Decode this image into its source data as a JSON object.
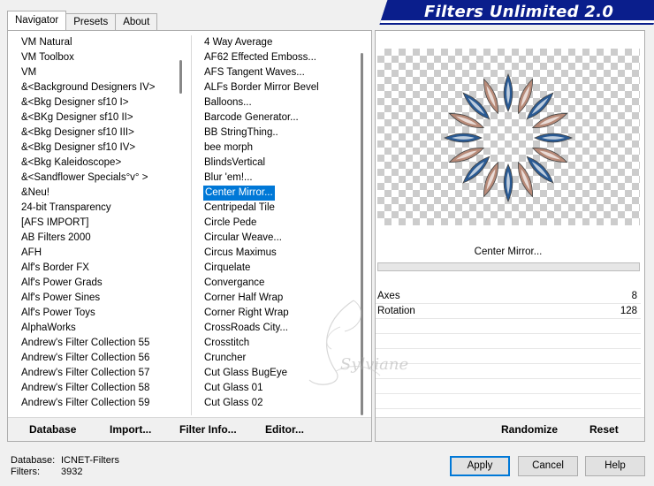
{
  "tabs": [
    "Navigator",
    "Presets",
    "About"
  ],
  "banner_title": "Filters Unlimited 2.0",
  "categories": [
    "VM Natural",
    "VM Toolbox",
    "VM",
    "&<Background Designers IV>",
    "&<Bkg Designer sf10 I>",
    "&<BKg Designer sf10 II>",
    "&<Bkg Designer sf10 III>",
    "&<Bkg Designer sf10 IV>",
    "&<Bkg Kaleidoscope>",
    "&<Sandflower Specials°v° >",
    "&Neu!",
    "24-bit Transparency",
    "[AFS IMPORT]",
    "AB Filters 2000",
    "AFH",
    "Alf's Border FX",
    "Alf's Power Grads",
    "Alf's Power Sines",
    "Alf's Power Toys",
    "AlphaWorks",
    "Andrew's Filter Collection 55",
    "Andrew's Filter Collection 56",
    "Andrew's Filter Collection 57",
    "Andrew's Filter Collection 58",
    "Andrew's Filter Collection 59"
  ],
  "filters": [
    "4 Way Average",
    "AF62 Effected Emboss...",
    "AFS Tangent Waves...",
    "ALFs Border Mirror Bevel",
    "Balloons...",
    "Barcode Generator...",
    "BB StringThing..",
    "bee morph",
    "BlindsVertical",
    "Blur 'em!...",
    "Center Mirror...",
    "Centripedal Tile",
    "Circle Pede",
    "Circular Weave...",
    "Circus Maximus",
    "Cirquelate",
    "Convergance",
    "Corner Half Wrap",
    "Corner Right Wrap",
    "CrossRoads City...",
    "Crosstitch",
    "Cruncher",
    "Cut Glass  BugEye",
    "Cut Glass 01",
    "Cut Glass 02"
  ],
  "selected_filter_index": 10,
  "left_buttons": {
    "database": "Database",
    "import": "Import...",
    "filter_info": "Filter Info...",
    "editor": "Editor..."
  },
  "current_filter": "Center Mirror...",
  "params": [
    {
      "name": "Axes",
      "value": "8"
    },
    {
      "name": "Rotation",
      "value": "128"
    }
  ],
  "right_buttons": {
    "randomize": "Randomize",
    "reset": "Reset"
  },
  "status": {
    "database_label": "Database:",
    "database_value": "ICNET-Filters",
    "filters_label": "Filters:",
    "filters_value": "3932"
  },
  "dialog_buttons": {
    "apply": "Apply",
    "cancel": "Cancel",
    "help": "Help"
  },
  "watermark_text": "Sylviane",
  "colors": {
    "banner": "#0a1e8c",
    "selection": "#0078d7"
  }
}
